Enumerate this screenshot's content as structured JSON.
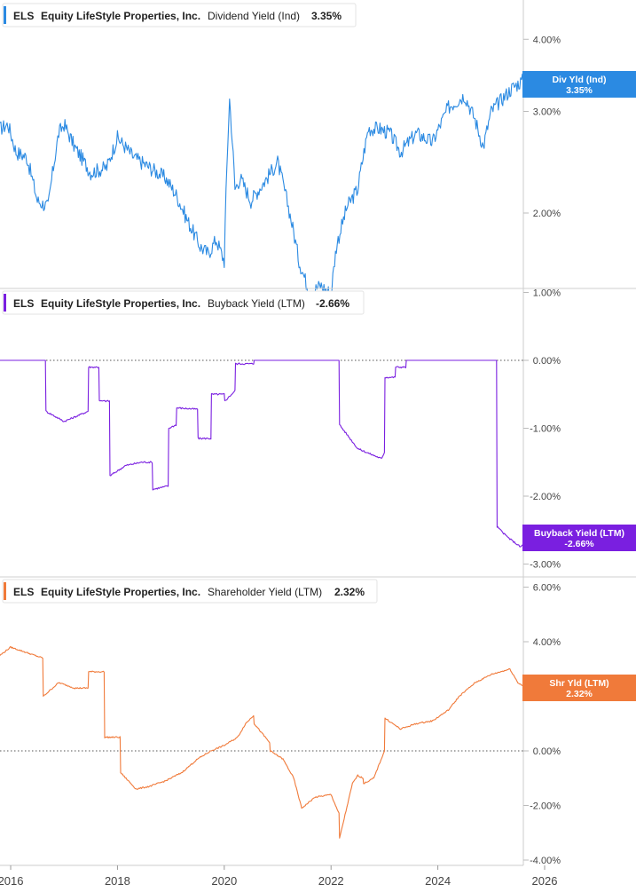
{
  "colors": {
    "dividend": "#2b8ae2",
    "buyback": "#7a1fe0",
    "shareholder": "#f07a3a",
    "grid": "#d9d9d9",
    "zero_line": "#555555",
    "axis_text": "#444444"
  },
  "panels": [
    {
      "ticker": "ELS",
      "company": "Equity LifeStyle Properties, Inc.",
      "metric": "Dividend Yield (Ind)",
      "value": "3.35%",
      "badge_line1": "Div Yld (Ind)",
      "badge_line2": "3.35%"
    },
    {
      "ticker": "ELS",
      "company": "Equity LifeStyle Properties, Inc.",
      "metric": "Buyback Yield (LTM)",
      "value": "-2.66%",
      "badge_line1": "Buyback Yield (LTM)",
      "badge_line2": "-2.66%"
    },
    {
      "ticker": "ELS",
      "company": "Equity LifeStyle Properties, Inc.",
      "metric": "Shareholder Yield (LTM)",
      "value": "2.32%",
      "badge_line1": "Shr Yld (LTM)",
      "badge_line2": "2.32%"
    }
  ],
  "chart_data": [
    {
      "type": "line",
      "title": "ELS Equity LifeStyle Properties, Inc. Dividend Yield (Ind) 3.35%",
      "series": [
        {
          "name": "Dividend Yield (Ind)",
          "x": [
            2015.8,
            2015.95,
            2016.1,
            2016.3,
            2016.5,
            2016.7,
            2016.9,
            2017.0,
            2017.2,
            2017.5,
            2017.8,
            2018.0,
            2018.3,
            2018.6,
            2018.9,
            2019.1,
            2019.3,
            2019.55,
            2019.7,
            2019.85,
            2020.0,
            2020.1,
            2020.2,
            2020.3,
            2020.5,
            2020.8,
            2021.0,
            2021.2,
            2021.4,
            2021.6,
            2021.8,
            2022.0,
            2022.1,
            2022.3,
            2022.5,
            2022.7,
            2022.9,
            2023.1,
            2023.3,
            2023.6,
            2023.9,
            2024.2,
            2024.5,
            2024.7,
            2024.85,
            2025.0,
            2025.2,
            2025.4,
            2025.6,
            2025.65
          ],
          "values": [
            2.8,
            2.85,
            2.55,
            2.5,
            2.1,
            2.05,
            2.75,
            2.85,
            2.6,
            2.35,
            2.4,
            2.7,
            2.5,
            2.4,
            2.3,
            2.15,
            1.95,
            1.75,
            1.7,
            1.8,
            1.65,
            3.15,
            2.2,
            2.3,
            2.1,
            2.3,
            2.45,
            2.05,
            1.65,
            1.45,
            1.5,
            1.45,
            1.75,
            2.05,
            2.2,
            2.8,
            2.8,
            2.75,
            2.55,
            2.75,
            2.65,
            3.05,
            3.2,
            2.9,
            2.6,
            3.0,
            3.15,
            3.3,
            3.4,
            3.35
          ]
        }
      ],
      "yticks": [
        "4.00%",
        "3.00%",
        "2.00%"
      ],
      "xticks": [
        "2016",
        "2018",
        "2020",
        "2022",
        "2024",
        "2026"
      ],
      "xlim": [
        2015.8,
        2026.05
      ],
      "ylim": [
        1.3,
        4.5
      ],
      "yscale": "log"
    },
    {
      "type": "line",
      "title": "ELS Equity LifeStyle Properties, Inc. Buyback Yield (LTM) -2.66%",
      "series": [
        {
          "name": "Buyback Yield (LTM)",
          "x": [
            2015.8,
            2016.65,
            2016.66,
            2017.0,
            2017.3,
            2017.45,
            2017.46,
            2017.65,
            2017.66,
            2017.85,
            2017.86,
            2018.15,
            2018.45,
            2018.65,
            2018.66,
            2018.95,
            2018.96,
            2019.1,
            2019.11,
            2019.5,
            2019.51,
            2019.75,
            2019.76,
            2020.0,
            2020.01,
            2020.2,
            2020.21,
            2020.55,
            2020.56,
            2022.15,
            2022.16,
            2022.5,
            2022.8,
            2022.95,
            2023.0,
            2023.01,
            2023.2,
            2023.21,
            2023.4,
            2023.41,
            2025.1,
            2025.11,
            2025.3,
            2025.55,
            2025.65
          ],
          "values": [
            0.0,
            0.0,
            -0.75,
            -0.9,
            -0.8,
            -0.75,
            -0.1,
            -0.1,
            -0.6,
            -0.6,
            -1.7,
            -1.55,
            -1.5,
            -1.5,
            -1.9,
            -1.85,
            -1.0,
            -0.95,
            -0.7,
            -0.72,
            -1.15,
            -1.15,
            -0.5,
            -0.5,
            -0.6,
            -0.45,
            -0.05,
            -0.05,
            0.0,
            0.0,
            -0.95,
            -1.3,
            -1.4,
            -1.45,
            -1.35,
            -0.25,
            -0.25,
            -0.1,
            -0.1,
            0.0,
            0.0,
            -2.45,
            -2.6,
            -2.75,
            -2.66
          ]
        }
      ],
      "yticks": [
        "1.00%",
        "0.00%",
        "-1.00%",
        "-2.00%",
        "-3.00%"
      ],
      "xlim": [
        2015.8,
        2026.05
      ],
      "ylim": [
        -3.0,
        1.0
      ]
    },
    {
      "type": "line",
      "title": "ELS Equity LifeStyle Properties, Inc. Shareholder Yield (LTM) 2.32%",
      "series": [
        {
          "name": "Shareholder Yield (LTM)",
          "x": [
            2015.8,
            2016.0,
            2016.3,
            2016.6,
            2016.61,
            2016.9,
            2017.2,
            2017.45,
            2017.46,
            2017.75,
            2017.76,
            2018.05,
            2018.06,
            2018.35,
            2018.6,
            2018.9,
            2019.2,
            2019.5,
            2019.75,
            2020.0,
            2020.25,
            2020.4,
            2020.55,
            2020.56,
            2020.85,
            2020.86,
            2021.1,
            2021.3,
            2021.45,
            2021.7,
            2022.0,
            2022.15,
            2022.16,
            2022.4,
            2022.5,
            2022.6,
            2022.61,
            2022.8,
            2023.0,
            2023.01,
            2023.3,
            2023.6,
            2023.9,
            2024.2,
            2024.4,
            2024.7,
            2025.0,
            2025.35,
            2025.5,
            2025.65
          ],
          "values": [
            3.5,
            3.8,
            3.6,
            3.4,
            2.0,
            2.5,
            2.3,
            2.3,
            2.9,
            2.9,
            0.5,
            0.5,
            -0.8,
            -1.4,
            -1.3,
            -1.1,
            -0.8,
            -0.3,
            0.0,
            0.2,
            0.5,
            1.0,
            1.3,
            1.0,
            0.3,
            0.0,
            -0.3,
            -1.0,
            -2.1,
            -1.7,
            -1.6,
            -2.3,
            -3.2,
            -1.2,
            -0.9,
            -1.0,
            -1.2,
            -1.0,
            0.0,
            1.2,
            0.8,
            1.0,
            1.1,
            1.5,
            2.0,
            2.5,
            2.8,
            3.0,
            2.5,
            2.32
          ]
        }
      ],
      "yticks": [
        "6.00%",
        "4.00%",
        "2.00%",
        "0.00%",
        "-2.00%",
        "-4.00%"
      ],
      "xticks": [
        "2016",
        "2018",
        "2020",
        "2022",
        "2024",
        "2026"
      ],
      "xlim": [
        2015.8,
        2026.05
      ],
      "ylim": [
        -4.0,
        6.0
      ]
    }
  ]
}
